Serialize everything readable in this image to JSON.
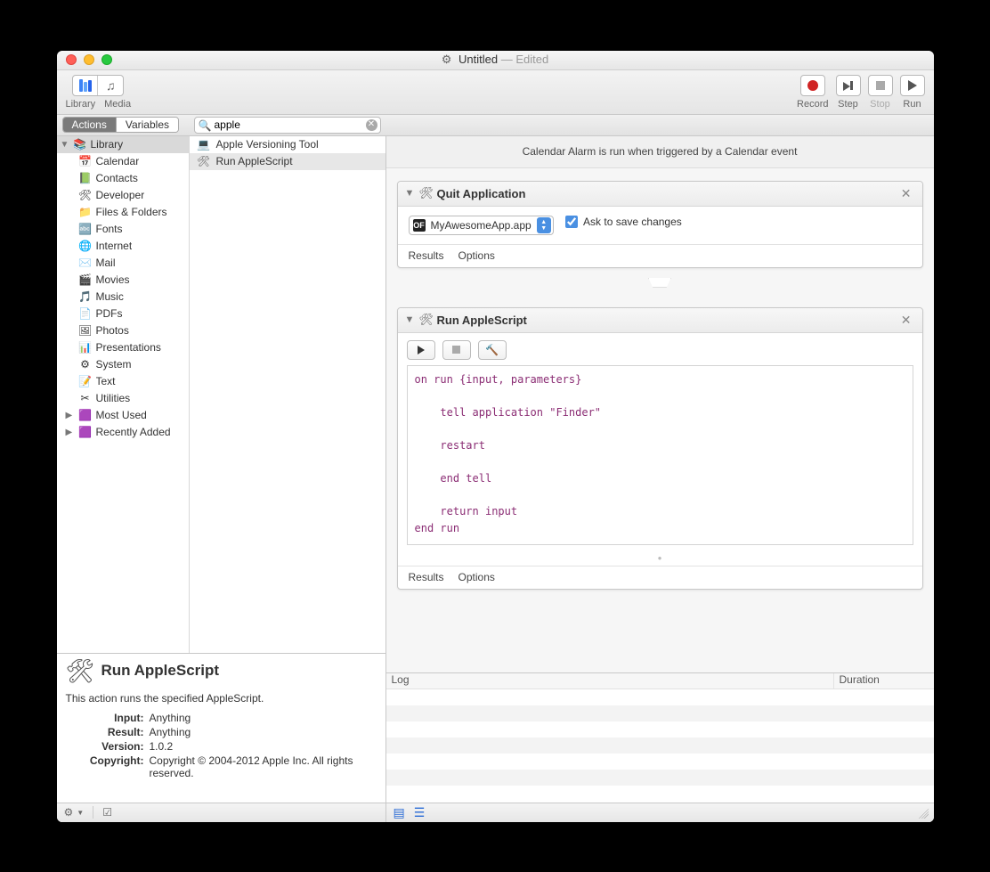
{
  "window": {
    "doc_title": "Untitled",
    "edited": "— Edited"
  },
  "toolbar": {
    "library_label": "Library",
    "media_label": "Media",
    "record_label": "Record",
    "step_label": "Step",
    "stop_label": "Stop",
    "run_label": "Run"
  },
  "subbar": {
    "actions_label": "Actions",
    "variables_label": "Variables",
    "search_value": "apple"
  },
  "banner": "Calendar Alarm is run when triggered by a Calendar event",
  "library_tree": {
    "root": "Library",
    "items": [
      {
        "icon": "📅",
        "label": "Calendar"
      },
      {
        "icon": "📗",
        "label": "Contacts"
      },
      {
        "icon": "🛠",
        "label": "Developer"
      },
      {
        "icon": "📁",
        "label": "Files & Folders"
      },
      {
        "icon": "🔤",
        "label": "Fonts"
      },
      {
        "icon": "🌐",
        "label": "Internet"
      },
      {
        "icon": "✉️",
        "label": "Mail"
      },
      {
        "icon": "🎬",
        "label": "Movies"
      },
      {
        "icon": "🎵",
        "label": "Music"
      },
      {
        "icon": "📄",
        "label": "PDFs"
      },
      {
        "icon": "🖼",
        "label": "Photos"
      },
      {
        "icon": "📊",
        "label": "Presentations"
      },
      {
        "icon": "⚙",
        "label": "System"
      },
      {
        "icon": "📝",
        "label": "Text"
      },
      {
        "icon": "✂",
        "label": "Utilities"
      }
    ],
    "extras": [
      {
        "icon": "🟪",
        "label": "Most Used"
      },
      {
        "icon": "🟪",
        "label": "Recently Added"
      }
    ]
  },
  "action_list": [
    {
      "icon": "💻",
      "label": "Apple Versioning Tool",
      "selected": false
    },
    {
      "icon": "🛠",
      "label": "Run AppleScript",
      "selected": true
    }
  ],
  "info": {
    "title": "Run AppleScript",
    "desc": "This action runs the specified AppleScript.",
    "rows": {
      "Input": "Anything",
      "Result": "Anything",
      "Version": "1.0.2",
      "Copyright": "Copyright © 2004-2012 Apple Inc.  All rights reserved."
    }
  },
  "workflow": {
    "block1": {
      "title": "Quit Application",
      "app_name": "MyAwesomeApp.app",
      "ask_label": "Ask to save changes",
      "ask_checked": true,
      "results_label": "Results",
      "options_label": "Options"
    },
    "block2": {
      "title": "Run AppleScript",
      "code": "on run {input, parameters}\n\n    tell application \"Finder\"\n\n    restart\n\n    end tell\n\n    return input\nend run",
      "results_label": "Results",
      "options_label": "Options"
    }
  },
  "log": {
    "col_log": "Log",
    "col_duration": "Duration"
  }
}
